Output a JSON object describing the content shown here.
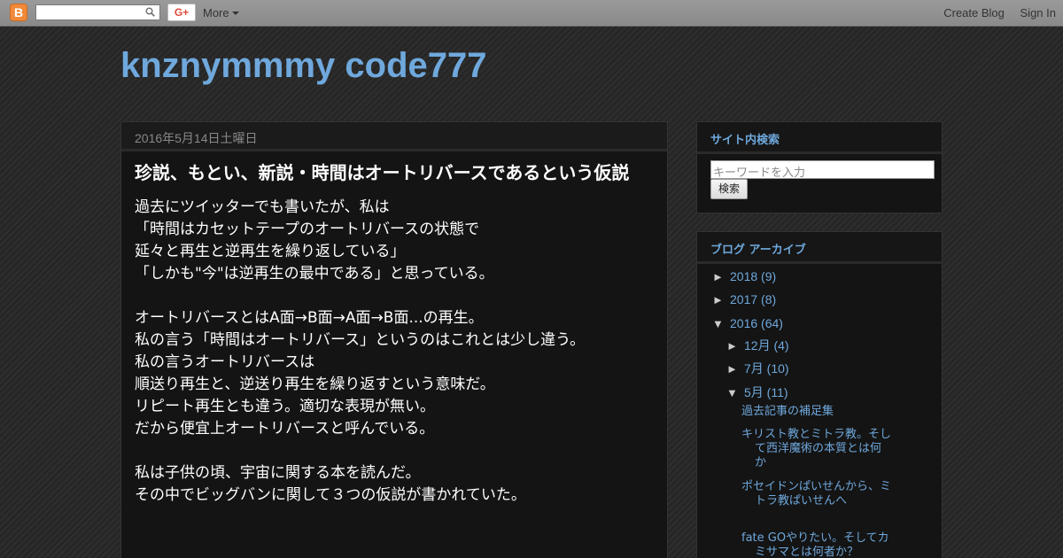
{
  "navbar": {
    "logo_letter": "B",
    "gplus_label": "G+",
    "more_label": "More",
    "create_blog": "Create Blog",
    "sign_in": "Sign In"
  },
  "blog": {
    "title": "knznymmmy code777"
  },
  "post": {
    "date": "2016年5月14日土曜日",
    "title": "珍説、もとい、新説・時間はオートリバースであるという仮説",
    "paragraphs": [
      [
        "過去にツイッターでも書いたが、私は",
        "「時間はカセットテープのオートリバースの状態で",
        "延々と再生と逆再生を繰り返している」",
        "「しかも\"今\"は逆再生の最中である」と思っている。"
      ],
      [
        "オートリバースとはA面→B面→A面→B面...の再生。",
        "私の言う「時間はオートリバース」というのはこれとは少し違う。",
        "私の言うオートリバースは",
        "順送り再生と、逆送り再生を繰り返すという意味だ。",
        "リピート再生とも違う。適切な表現が無い。",
        "だから便宜上オートリバースと呼んでいる。"
      ],
      [
        "私は子供の頃、宇宙に関する本を読んだ。",
        "その中でビッグバンに関して３つの仮説が書かれていた。"
      ]
    ]
  },
  "sidebar": {
    "search": {
      "title": "サイト内検索",
      "placeholder": "キーワードを入力",
      "button": "検索"
    },
    "archive": {
      "title": "ブログ アーカイブ",
      "years": [
        {
          "toggle": "►",
          "label": "2018 (9)"
        },
        {
          "toggle": "►",
          "label": "2017 (8)"
        },
        {
          "toggle": "▼",
          "label": "2016 (64)"
        }
      ],
      "months": [
        {
          "toggle": "►",
          "label": "12月 (4)"
        },
        {
          "toggle": "►",
          "label": "7月 (10)"
        },
        {
          "toggle": "▼",
          "label": "5月 (11)"
        }
      ],
      "posts": [
        "過去記事の補足集",
        "キリスト教とミトラ教。そして西洋魔術の本質とは何か",
        "ポセイドンぱいせんから、ミトラ教ぱいせんへ",
        "fate GOやりたい。そしてカミサマとは何者か？"
      ]
    }
  },
  "colors": {
    "link": "#6fa8dc",
    "background": "#292929",
    "panel": "#141414"
  }
}
